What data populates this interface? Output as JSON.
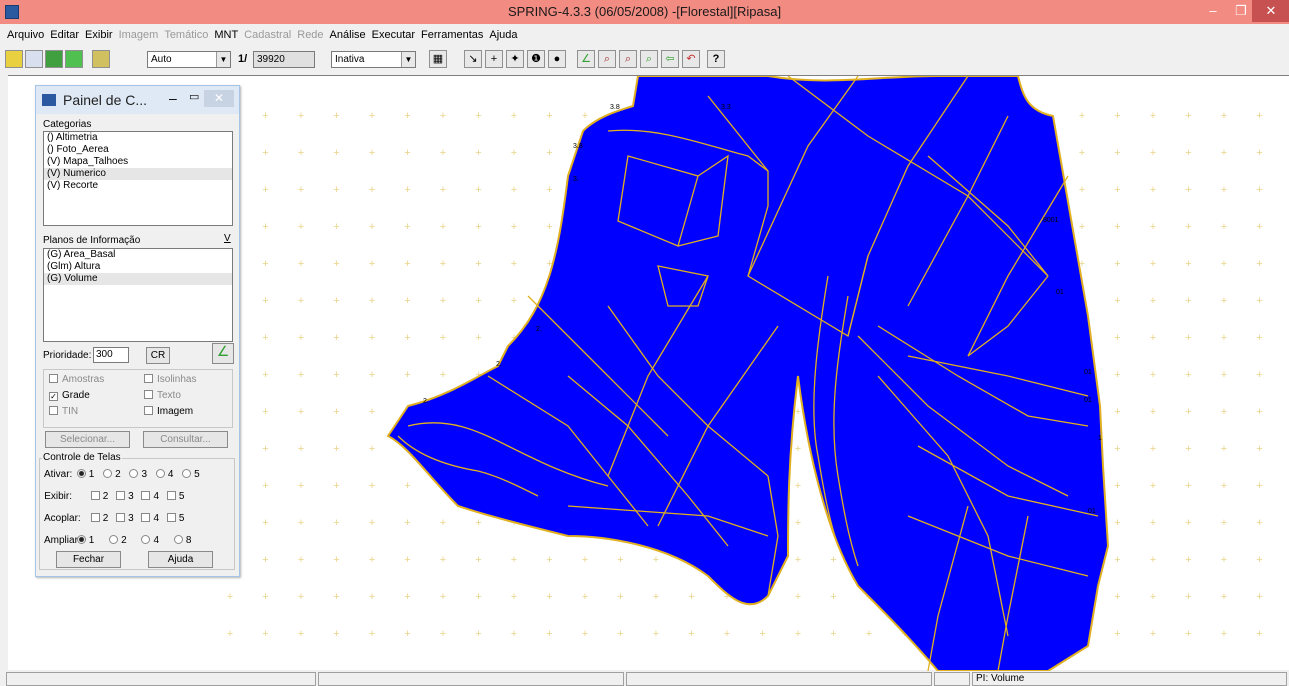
{
  "titlebar": {
    "title": "SPRING-4.3.3 (06/05/2008) -[Florestal][Ripasa]",
    "minimize": "–",
    "maximize": "❐",
    "close": "✕"
  },
  "menu": [
    {
      "label": "Arquivo",
      "enabled": true
    },
    {
      "label": "Editar",
      "enabled": true
    },
    {
      "label": "Exibir",
      "enabled": true
    },
    {
      "label": "Imagem",
      "enabled": false
    },
    {
      "label": "Temático",
      "enabled": false
    },
    {
      "label": "MNT",
      "enabled": true
    },
    {
      "label": "Cadastral",
      "enabled": false
    },
    {
      "label": "Rede",
      "enabled": false
    },
    {
      "label": "Análise",
      "enabled": true
    },
    {
      "label": "Executar",
      "enabled": true
    },
    {
      "label": "Ferramentas",
      "enabled": true
    },
    {
      "label": "Ajuda",
      "enabled": true
    }
  ],
  "toolbar": {
    "zoom_mode": "Auto",
    "scale_prefix": "1/",
    "scale_value": "39920",
    "mode": "Inativa",
    "help": "?"
  },
  "map": {
    "labels": [
      "3.8",
      "3.3",
      "3.8",
      "3.",
      "2.",
      "2.",
      "2.",
      "8001",
      "01",
      "01",
      "01",
      "1",
      "01"
    ]
  },
  "panel": {
    "title": "Painel de C...",
    "categorias_label": "Categorias",
    "categorias": [
      "() Altimetria",
      "() Foto_Aerea",
      "(V) Mapa_Talhoes",
      "(V) Numerico",
      "(V) Recorte"
    ],
    "planos_label": "Planos de Informação",
    "planos_flag": "V",
    "planos": [
      "(G) Area_Basal",
      "(Glm) Altura",
      "(G) Volume"
    ],
    "prioridade_label": "Prioridade:",
    "prioridade_value": "300",
    "cr_button": "CR",
    "checks": {
      "amostras": "Amostras",
      "isolinhas": "Isolinhas",
      "grade": "Grade",
      "texto": "Texto",
      "tin": "TIN",
      "imagem": "Imagem"
    },
    "selecionar": "Selecionar...",
    "consultar": "Consultar...",
    "controle_label": "Controle de Telas",
    "ativar_label": "Ativar:",
    "exibir_label": "Exibir:",
    "acoplar_label": "Acoplar:",
    "ampliar_label": "Ampliar:",
    "n1": "1",
    "n2": "2",
    "n3": "3",
    "n4": "4",
    "n5": "5",
    "n8": "8",
    "fechar": "Fechar",
    "ajuda": "Ajuda"
  },
  "status": {
    "pi": "PI: Volume"
  },
  "colors": {
    "titlebar": "#f28b82",
    "polygon_fill": "#0000ff",
    "boundary": "#e0b020",
    "grid_cross": "#e8d48a"
  }
}
